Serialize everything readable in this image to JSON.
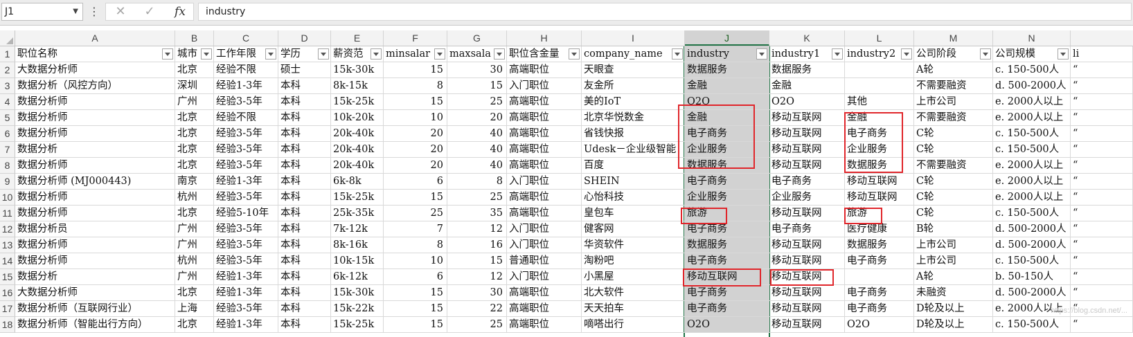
{
  "formula_bar": {
    "name_box": "J1",
    "menu_glyph": "⋮",
    "cancel_glyph": "✕",
    "enter_glyph": "✓",
    "fx_label": "fx",
    "formula": "industry"
  },
  "columns": [
    "A",
    "B",
    "C",
    "D",
    "E",
    "F",
    "G",
    "H",
    "I",
    "J",
    "K",
    "L",
    "M",
    "N"
  ],
  "selected_column": "J",
  "header_row": [
    "职位名称",
    "城市",
    "工作年限",
    "学历",
    "薪资范",
    "minsalar",
    "maxsala",
    "职位含金量",
    "company_name",
    "industry",
    "industry1",
    "industry2",
    "公司阶段",
    "公司规模",
    "li"
  ],
  "rows": [
    {
      "n": "2",
      "c": [
        "大数据分析师",
        "北京",
        "经验不限",
        "硕士",
        "15k-30k",
        "15",
        "30",
        "高端职位",
        "天眼查",
        "数据服务",
        "数据服务",
        "",
        "A轮",
        "c. 150-500人",
        "“"
      ]
    },
    {
      "n": "3",
      "c": [
        "数据分析（风控方向）",
        "深圳",
        "经验1-3年",
        "本科",
        "8k-15k",
        "8",
        "15",
        "入门职位",
        "友金所",
        "金融",
        "金融",
        "",
        "不需要融资",
        "d. 500-2000人",
        "“"
      ]
    },
    {
      "n": "4",
      "c": [
        "数据分析师",
        "广州",
        "经验3-5年",
        "本科",
        "15k-25k",
        "15",
        "25",
        "高端职位",
        "美的IoT",
        "O2O",
        "O2O",
        "其他",
        "上市公司",
        "e. 2000人以上",
        "“"
      ]
    },
    {
      "n": "5",
      "c": [
        "数据分析师",
        "北京",
        "经验不限",
        "本科",
        "10k-20k",
        "10",
        "20",
        "高端职位",
        "北京华悦数金",
        "金融",
        "移动互联网",
        "金融",
        "不需要融资",
        "e. 2000人以上",
        "“"
      ]
    },
    {
      "n": "6",
      "c": [
        "数据分析师",
        "北京",
        "经验3-5年",
        "本科",
        "20k-40k",
        "20",
        "40",
        "高端职位",
        "省钱快报",
        "电子商务",
        "移动互联网",
        "电子商务",
        "C轮",
        "c. 150-500人",
        "“"
      ]
    },
    {
      "n": "7",
      "c": [
        "数据分析",
        "北京",
        "经验3-5年",
        "本科",
        "20k-40k",
        "20",
        "40",
        "高端职位",
        "Udesk－企业级智能",
        "企业服务",
        "移动互联网",
        "企业服务",
        "C轮",
        "c. 150-500人",
        "“"
      ]
    },
    {
      "n": "8",
      "c": [
        "数据分析师",
        "北京",
        "经验3-5年",
        "本科",
        "20k-40k",
        "20",
        "40",
        "高端职位",
        "百度",
        "数据服务",
        "移动互联网",
        "数据服务",
        "不需要融资",
        "e. 2000人以上",
        "“"
      ]
    },
    {
      "n": "9",
      "c": [
        "数据分析师 (MJ000443)",
        "南京",
        "经验1-3年",
        "本科",
        "6k-8k",
        "6",
        "8",
        "入门职位",
        "SHEIN",
        "电子商务",
        "电子商务",
        "移动互联网",
        "C轮",
        "e. 2000人以上",
        "“"
      ]
    },
    {
      "n": "10",
      "c": [
        "数据分析师",
        "杭州",
        "经验3-5年",
        "本科",
        "15k-25k",
        "15",
        "25",
        "高端职位",
        "心怡科技",
        "企业服务",
        "企业服务",
        "移动互联网",
        "C轮",
        "e. 2000人以上",
        "“"
      ]
    },
    {
      "n": "11",
      "c": [
        "数据分析师",
        "北京",
        "经验5-10年",
        "本科",
        "25k-35k",
        "25",
        "35",
        "高端职位",
        "皇包车",
        "旅游",
        "移动互联网",
        "旅游",
        "C轮",
        "c. 150-500人",
        "“"
      ]
    },
    {
      "n": "12",
      "c": [
        "数据分析员",
        "广州",
        "经验3-5年",
        "本科",
        "7k-12k",
        "7",
        "12",
        "入门职位",
        "健客网",
        "电子商务",
        "电子商务",
        "医疗健康",
        "B轮",
        "d. 500-2000人",
        "“"
      ]
    },
    {
      "n": "13",
      "c": [
        "数据分析师",
        "广州",
        "经验3-5年",
        "本科",
        "8k-16k",
        "8",
        "16",
        "入门职位",
        "华资软件",
        "数据服务",
        "移动互联网",
        "数据服务",
        "上市公司",
        "d. 500-2000人",
        "“"
      ]
    },
    {
      "n": "14",
      "c": [
        "数据分析师",
        "杭州",
        "经验3-5年",
        "本科",
        "10k-15k",
        "10",
        "15",
        "普通职位",
        "淘粉吧",
        "电子商务",
        "移动互联网",
        "电子商务",
        "上市公司",
        "c. 150-500人",
        "“"
      ]
    },
    {
      "n": "15",
      "c": [
        "数据分析",
        "广州",
        "经验1-3年",
        "本科",
        "6k-12k",
        "6",
        "12",
        "入门职位",
        "小黑屋",
        "移动互联网",
        "移动互联网",
        "",
        "A轮",
        "b. 50-150人",
        "“"
      ]
    },
    {
      "n": "16",
      "c": [
        "大数据分析师",
        "北京",
        "经验1-3年",
        "本科",
        "15k-30k",
        "15",
        "30",
        "高端职位",
        "北大软件",
        "电子商务",
        "移动互联网",
        "电子商务",
        "未融资",
        "d. 500-2000人",
        "“"
      ]
    },
    {
      "n": "17",
      "c": [
        "数据分析师（互联网行业）",
        "上海",
        "经验3-5年",
        "本科",
        "15k-22k",
        "15",
        "22",
        "高端职位",
        "天天拍车",
        "电子商务",
        "移动互联网",
        "电子商务",
        "D轮及以上",
        "e. 2000人以上",
        "“"
      ]
    },
    {
      "n": "18",
      "c": [
        "数据分析师（智能出行方向）",
        "北京",
        "经验1-3年",
        "本科",
        "15k-25k",
        "15",
        "25",
        "高端职位",
        "嘀嗒出行",
        "O2O",
        "移动互联网",
        "O2O",
        "D轮及以上",
        "c. 150-500人",
        "“"
      ]
    }
  ],
  "watermark": "https://blog.csdn.net/..."
}
